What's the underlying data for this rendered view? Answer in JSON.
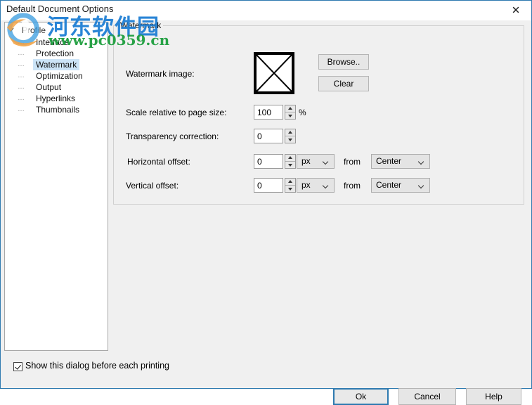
{
  "window": {
    "title": "Default Document Options",
    "close_icon": "close-icon"
  },
  "tree": {
    "root": {
      "label": "Profile",
      "expander_glyph": "✓"
    },
    "items": [
      {
        "label": "Interface",
        "selected": false
      },
      {
        "label": "Protection",
        "selected": false
      },
      {
        "label": "Watermark",
        "selected": true
      },
      {
        "label": "Optimization",
        "selected": false
      },
      {
        "label": "Output",
        "selected": false
      },
      {
        "label": "Hyperlinks",
        "selected": false
      },
      {
        "label": "Thumbnails",
        "selected": false
      }
    ]
  },
  "groupbox": {
    "title": "Watermark",
    "fields": {
      "watermark_image": {
        "label": "Watermark image:",
        "browse_button": "Browse..",
        "clear_button": "Clear"
      },
      "scale": {
        "label": "Scale relative to page size:",
        "value": "100",
        "unit": "%"
      },
      "transparency": {
        "label": "Transparency correction:",
        "value": "0"
      },
      "horizontal_offset": {
        "label": "Horizontal offset:",
        "value": "0",
        "unit": "px",
        "from_label": "from",
        "origin": "Center"
      },
      "vertical_offset": {
        "label": "Vertical offset:",
        "value": "0",
        "unit": "px",
        "from_label": "from",
        "origin": "Center"
      }
    }
  },
  "footer": {
    "show_dialog_checkbox_label": "Show this dialog before each printing",
    "show_dialog_checked": true,
    "ok_button": "Ok",
    "cancel_button": "Cancel",
    "help_button": "Help"
  },
  "site_watermark": {
    "chinese_text": "河东软件园",
    "url_text": "www.pc0359.cn",
    "chinese_color": "#1f7fd4",
    "url_color": "#1e9e3e"
  },
  "colors": {
    "window_border": "#2e7ab0",
    "dialog_background": "#f0f0f0",
    "selection_highlight": "#cce4f7",
    "focus_border": "#2e7ab0"
  }
}
